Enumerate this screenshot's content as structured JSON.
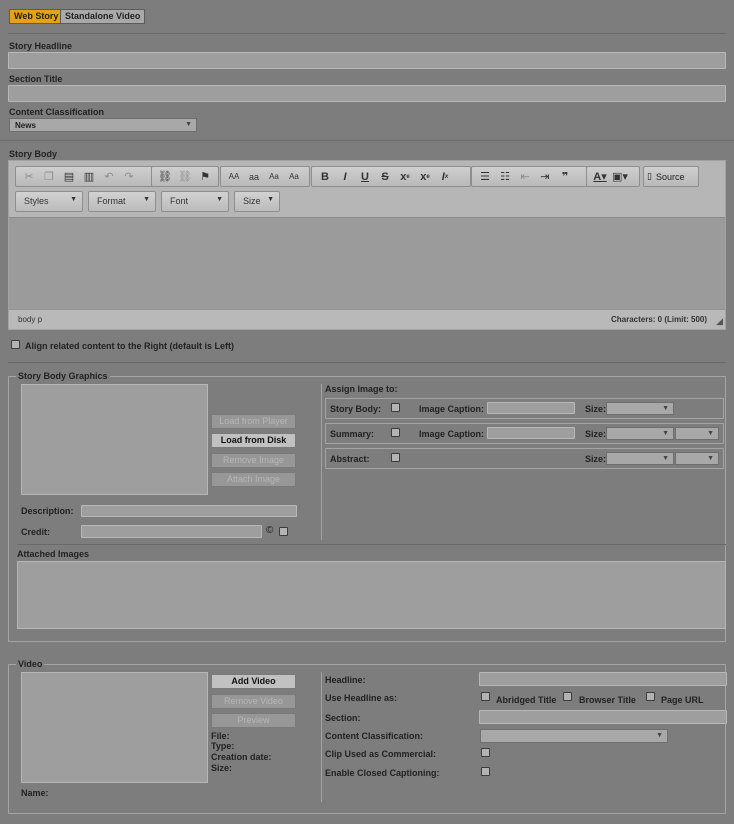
{
  "mode_tabs": [
    {
      "label": "Web Story",
      "active": true
    },
    {
      "label": "Standalone Video",
      "active": false
    }
  ],
  "fields": {
    "story_headline_label": "Story Headline",
    "section_title_label": "Section Title",
    "content_classification_label": "Content Classification",
    "content_classification_value": "News"
  },
  "story_body": {
    "label": "Story Body",
    "toolbar_styles": "Styles",
    "toolbar_format": "Format",
    "toolbar_font": "Font",
    "toolbar_size": "Size",
    "source_label": "Source",
    "path": "body  p",
    "char_count": "Characters: 0 (Limit: 500)"
  },
  "align_right_label": "Align related content to the Right (default is Left)",
  "graphics": {
    "legend": "Story Body Graphics",
    "load_from_player": "Load from Player",
    "load_from_disk": "Load from Disk",
    "remove_image": "Remove Image",
    "attach_image": "Attach Image",
    "description_label": "Description:",
    "credit_label": "Credit:",
    "copyright_symbol": "©",
    "assign_title": "Assign Image to:",
    "story_body_label": "Story Body:",
    "summary_label": "Summary:",
    "abstract_label": "Abstract:",
    "image_caption_label": "Image Caption:",
    "size_label": "Size:",
    "attached_images_label": "Attached Images"
  },
  "video": {
    "legend": "Video",
    "add_video": "Add Video",
    "remove_video": "Remove Video",
    "preview": "Preview",
    "file_label": "File:",
    "type_label": "Type:",
    "creation_date_label": "Creation date:",
    "size_label": "Size:",
    "name_label": "Name:",
    "headline_label": "Headline:",
    "use_headline_as_label": "Use Headline as:",
    "abridged_title": "Abridged Title",
    "browser_title": "Browser Title",
    "page_url": "Page URL",
    "section_label": "Section:",
    "content_classification_label": "Content Classification:",
    "clip_commercial_label": "Clip Used as Commercial:",
    "closed_captioning_label": "Enable Closed Captioning:"
  },
  "icons": {
    "cut": "cut-icon",
    "copy": "copy-icon",
    "paste": "paste-icon",
    "paste_text": "paste-text-icon",
    "undo": "undo-icon",
    "redo": "redo-icon",
    "link": "link-icon",
    "unlink": "unlink-icon",
    "anchor": "anchor-flag-icon",
    "bold": "B",
    "italic": "I",
    "underline": "U",
    "strike": "S"
  }
}
